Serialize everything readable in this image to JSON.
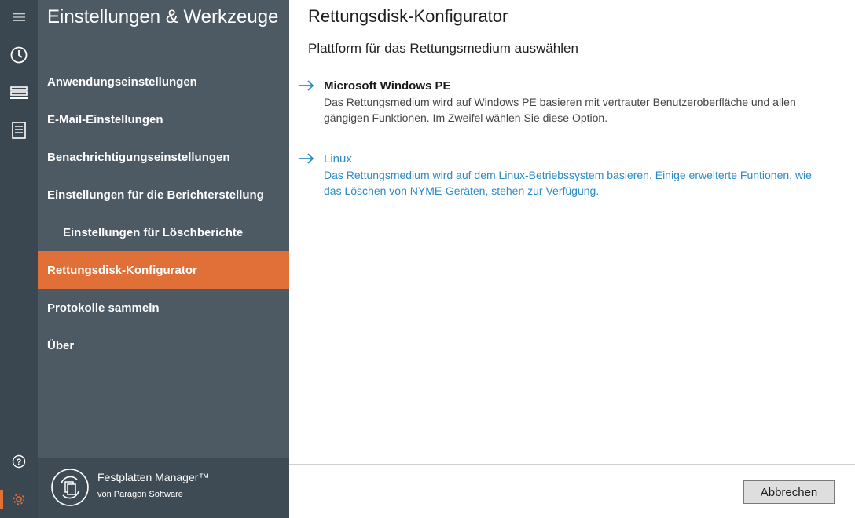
{
  "rail": {
    "icons": [
      "hamburger-menu-icon",
      "history-clock-icon",
      "disk-drives-icon",
      "report-list-icon",
      "help-icon",
      "settings-gear-icon"
    ],
    "accent_color": "#e07038"
  },
  "panel": {
    "title": "Einstellungen & Werkzeuge",
    "items": [
      {
        "label": "Anwendungseinstellungen"
      },
      {
        "label": "E-Mail-Einstellungen"
      },
      {
        "label": "Benachrichtigungseinstellungen"
      },
      {
        "label": "Einstellungen für die Berichterstellung"
      },
      {
        "label": "Einstellungen für Löschberichte"
      },
      {
        "label": "Rettungsdisk-Konfigurator"
      },
      {
        "label": "Protokolle sammeln"
      },
      {
        "label": "Über"
      }
    ],
    "active_item": "Rettungsdisk-Konfigurator",
    "footer": {
      "product": "Festplatten Manager™",
      "vendor": "von Paragon Software"
    }
  },
  "main": {
    "title": "Rettungsdisk-Konfigurator",
    "subtitle": "Plattform für das Rettungsmedium auswählen",
    "options": [
      {
        "label": "Microsoft Windows PE",
        "description": "Das Rettungsmedium wird auf Windows PE basieren mit vertrauter Benutzeroberfläche und allen gängigen Funktionen. Im Zweifel wählen Sie diese Option."
      },
      {
        "label": "Linux",
        "description": "Das Rettungsmedium wird auf dem Linux-Betriebssystem basieren. Einige erweiterte Funtionen, wie das Löschen von NYME-Geräten, stehen zur Verfügung."
      }
    ],
    "cancel_label": "Abbrechen",
    "link_color": "#2b8ac8"
  }
}
